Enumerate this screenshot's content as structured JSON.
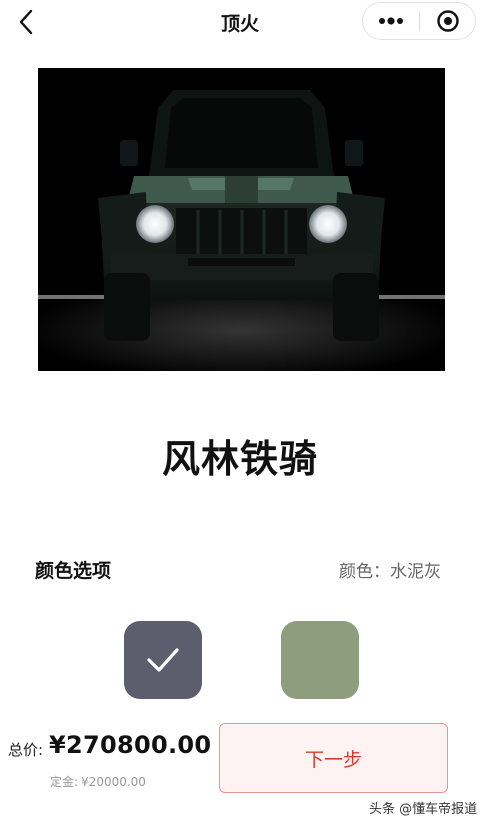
{
  "header": {
    "title": "顶火",
    "back_icon": "chevron-left-icon",
    "more_icon": "more-dots-icon",
    "close_icon": "target-close-icon"
  },
  "product": {
    "name": "风林铁骑",
    "image_alt": "dark green off-road SUV with round headlights on black background"
  },
  "options": {
    "title": "颜色选项",
    "color_prefix": "颜色：",
    "color_value": "水泥灰",
    "swatches": [
      {
        "color": "#5c5d6d",
        "selected": true
      },
      {
        "color": "#8d9d7d",
        "selected": false
      }
    ]
  },
  "footer": {
    "total_label": "总价:",
    "total_value": "¥270800.00",
    "deposit_label": "定金:",
    "deposit_value": "¥20000.00",
    "next_label": "下一步"
  },
  "watermark": "头条 @懂车帝报道",
  "colors": {
    "accent": "#d83a33",
    "button_bg": "#fdf3f2",
    "button_border": "#e8948f"
  }
}
